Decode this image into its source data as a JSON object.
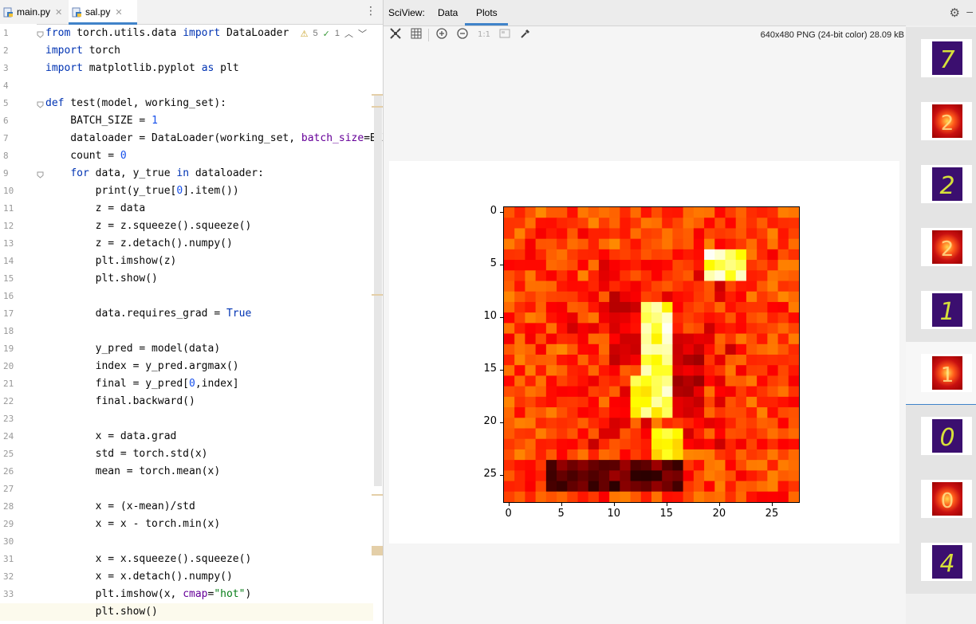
{
  "tabs": [
    {
      "label": "main.py",
      "active": false
    },
    {
      "label": "sal.py",
      "active": true
    }
  ],
  "inspection": {
    "warnings": "5",
    "ok": "1"
  },
  "code_lines": [
    [
      [
        "kw",
        "from"
      ],
      [
        "t",
        " torch.utils.data "
      ],
      [
        "kw",
        "import"
      ],
      [
        "t",
        " DataLoader"
      ]
    ],
    [
      [
        "kw",
        "import"
      ],
      [
        "t",
        " torch"
      ]
    ],
    [
      [
        "kw",
        "import"
      ],
      [
        "t",
        " matplotlib.pyplot "
      ],
      [
        "kw",
        "as"
      ],
      [
        "t",
        " plt"
      ]
    ],
    [],
    [
      [
        "kw",
        "def"
      ],
      [
        "t",
        " test(model, working_set):"
      ]
    ],
    [
      [
        "t",
        "    BATCH_SIZE = "
      ],
      [
        "num",
        "1"
      ]
    ],
    [
      [
        "t",
        "    dataloader = DataLoader(working_set, "
      ],
      [
        "kwarg",
        "batch_size"
      ],
      [
        "t",
        "=BATCH_SIZE)"
      ]
    ],
    [
      [
        "t",
        "    count = "
      ],
      [
        "num",
        "0"
      ]
    ],
    [
      [
        "t",
        "    "
      ],
      [
        "kw",
        "for"
      ],
      [
        "t",
        " data, y_true "
      ],
      [
        "kw",
        "in"
      ],
      [
        "t",
        " dataloader:"
      ]
    ],
    [
      [
        "t",
        "        print(y_true["
      ],
      [
        "num",
        "0"
      ],
      [
        "t",
        "].item())"
      ]
    ],
    [
      [
        "t",
        "        z = data"
      ]
    ],
    [
      [
        "t",
        "        z = z.squeeze().squeeze()"
      ]
    ],
    [
      [
        "t",
        "        z = z.detach().numpy()"
      ]
    ],
    [
      [
        "t",
        "        plt.imshow(z)"
      ]
    ],
    [
      [
        "t",
        "        plt.show()"
      ]
    ],
    [],
    [
      [
        "t",
        "        data.requires_grad = "
      ],
      [
        "kw",
        "True"
      ]
    ],
    [],
    [
      [
        "t",
        "        y_pred = model(data)"
      ]
    ],
    [
      [
        "t",
        "        index = y_pred.argmax()"
      ]
    ],
    [
      [
        "t",
        "        final = y_pred["
      ],
      [
        "num",
        "0"
      ],
      [
        "t",
        ",index]"
      ]
    ],
    [
      [
        "t",
        "        final.backward()"
      ]
    ],
    [],
    [
      [
        "t",
        "        x = data.grad"
      ]
    ],
    [
      [
        "t",
        "        std = torch.std(x)"
      ]
    ],
    [
      [
        "t",
        "        mean = torch.mean(x)"
      ]
    ],
    [],
    [
      [
        "t",
        "        x = (x-mean)/std"
      ]
    ],
    [
      [
        "t",
        "        x = x - torch.min(x)"
      ]
    ],
    [],
    [
      [
        "t",
        "        x = x.squeeze().squeeze()"
      ]
    ],
    [
      [
        "t",
        "        x = x.detach().numpy()"
      ]
    ],
    [
      [
        "t",
        "        plt.imshow(x, "
      ],
      [
        "kwarg",
        "cmap"
      ],
      [
        "t",
        "="
      ],
      [
        "str",
        "\"hot\""
      ],
      [
        "t",
        ")"
      ]
    ],
    [
      [
        "t",
        "        plt.show()"
      ]
    ]
  ],
  "sciview": {
    "title": "SciView:",
    "tabs": [
      "Data",
      "Plots"
    ],
    "active_tab": "Plots",
    "image_info": "640x480 PNG (24-bit color) 28.09 kB",
    "zoom_label": "1:1"
  },
  "toolbar_icons": [
    "fit-screen-icon",
    "grid-icon",
    "zoom-in-icon",
    "zoom-out-icon",
    "actual-size-icon",
    "background-icon",
    "color-picker-icon"
  ],
  "thumbnails": [
    {
      "digit": "7",
      "style": "viridis"
    },
    {
      "digit": "2",
      "style": "hot"
    },
    {
      "digit": "2",
      "style": "viridis"
    },
    {
      "digit": "2",
      "style": "hot"
    },
    {
      "digit": "1",
      "style": "viridis"
    },
    {
      "digit": "1",
      "style": "hot",
      "selected": true
    },
    {
      "digit": "0",
      "style": "viridis"
    },
    {
      "digit": "0",
      "style": "hot"
    },
    {
      "digit": "4",
      "style": "viridis"
    }
  ],
  "chart_data": {
    "type": "heatmap",
    "colormap": "hot",
    "xticks": [
      0,
      5,
      10,
      15,
      20,
      25
    ],
    "yticks": [
      0,
      5,
      10,
      15,
      20,
      25
    ],
    "shape": [
      28,
      28
    ],
    "hotspots": [
      {
        "row": 5,
        "col": 20,
        "value": 0.95
      },
      {
        "row": 11,
        "col": 14,
        "value": 0.95
      },
      {
        "row": 14,
        "col": 14,
        "value": 0.98
      },
      {
        "row": 17,
        "col": 13,
        "value": 0.9
      },
      {
        "row": 25,
        "col": 6,
        "value": 0.0
      }
    ]
  }
}
